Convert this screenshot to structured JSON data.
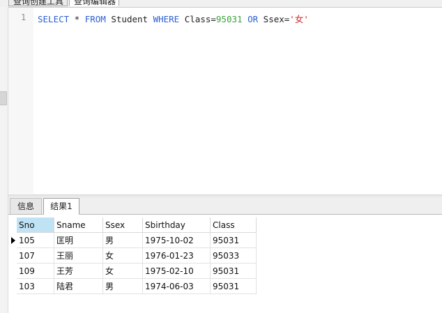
{
  "top_tabs": [
    "查询创建工具",
    "查询编辑器"
  ],
  "editor": {
    "line_number": "1",
    "tokens": [
      {
        "text": "SELECT",
        "kind": "keyword"
      },
      {
        "text": " * ",
        "kind": "plain"
      },
      {
        "text": "FROM",
        "kind": "keyword"
      },
      {
        "text": " Student ",
        "kind": "plain"
      },
      {
        "text": "WHERE",
        "kind": "keyword"
      },
      {
        "text": " Class=",
        "kind": "plain"
      },
      {
        "text": "95031",
        "kind": "number"
      },
      {
        "text": " ",
        "kind": "plain"
      },
      {
        "text": "OR",
        "kind": "keyword"
      },
      {
        "text": " Ssex=",
        "kind": "plain"
      },
      {
        "text": "'女'",
        "kind": "string"
      }
    ]
  },
  "result_tabs": {
    "info": "信息",
    "result": "结果1"
  },
  "grid": {
    "columns": [
      "Sno",
      "Sname",
      "Ssex",
      "Sbirthday",
      "Class"
    ],
    "selected_column": "Sno",
    "current_row": 0,
    "rows": [
      [
        "105",
        "匡明",
        "男",
        "1975-10-02",
        "95031"
      ],
      [
        "107",
        "王丽",
        "女",
        "1976-01-23",
        "95033"
      ],
      [
        "109",
        "王芳",
        "女",
        "1975-02-10",
        "95031"
      ],
      [
        "103",
        "陆君",
        "男",
        "1974-06-03",
        "95031"
      ]
    ]
  },
  "colors": {
    "keyword": "#2c5fcf",
    "number": "#38a13a",
    "string": "#cf2a2a",
    "selected_header": "#bfe3f5"
  }
}
